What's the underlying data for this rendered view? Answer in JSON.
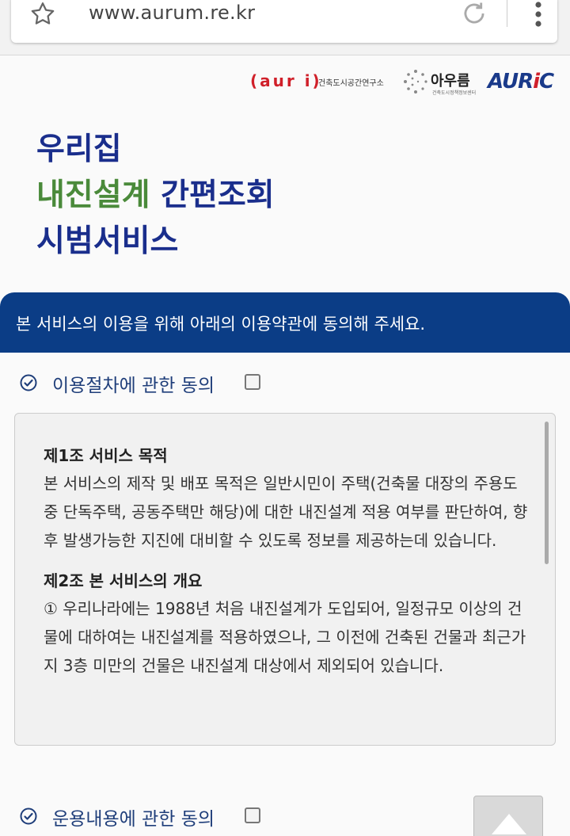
{
  "browser": {
    "url": "www.aurum.re.kr"
  },
  "logos": {
    "auri_mark": "(aur i)",
    "auri_name": "건축도시공간연구소",
    "aurum_name": "아우름",
    "aurum_sub": "건축도시정책정보센터",
    "auric": "AURIC"
  },
  "title": {
    "line1": "우리집",
    "line2_highlight": "내진설계",
    "line2_rest": " 간편조회",
    "line3": "시범서비스"
  },
  "banner": {
    "text": "본 서비스의 이용을 위해 아래의 이용약관에 동의해 주세요."
  },
  "consents": [
    {
      "label": "이용절차에 관한 동의",
      "checked": false
    },
    {
      "label": "운용내용에 관한 동의",
      "checked": false
    }
  ],
  "terms": {
    "articles": [
      {
        "title": "제1조 서비스 목적",
        "body": "본 서비스의 제작 및 배포 목적은 일반시민이 주택(건축물 대장의 주용도 중 단독주택, 공동주택만 해당)에 대한 내진설계 적용 여부를 판단하여, 향후 발생가능한 지진에 대비할 수 있도록 정보를 제공하는데 있습니다."
      },
      {
        "title": "제2조 본 서비스의 개요",
        "body": "① 우리나라에는 1988년 처음 내진설계가 도입되어, 일정규모 이상의 건물에 대하여는 내진설계를 적용하였으나, 그 이전에 건축된 건물과 최근가지 3층 미만의 건물은 내진설계 대상에서 제외되어 있습니다."
      }
    ]
  },
  "colors": {
    "brand_navy": "#0b3d86",
    "title_blue": "#1a2e8c",
    "title_green": "#4a8a3a",
    "auri_red": "#d0202a"
  },
  "icons": {
    "bookmark": "star-icon",
    "reload": "reload-icon",
    "menu": "kebab-menu-icon",
    "consent": "check-circle-icon",
    "scroll_top": "triangle-up-icon"
  }
}
